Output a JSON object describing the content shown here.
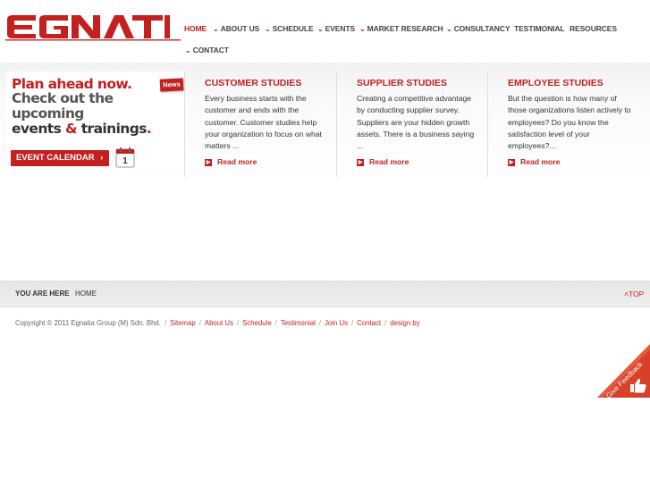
{
  "brand": {
    "logo_text": "EGNATIA",
    "accent": "#c42020"
  },
  "nav": {
    "items": [
      {
        "label": "HOME",
        "chevron": false,
        "active": true
      },
      {
        "label": "ABOUT US",
        "chevron": true
      },
      {
        "label": "SCHEDULE",
        "chevron": true
      },
      {
        "label": "EVENTS",
        "chevron": true
      },
      {
        "label": "MARKET RESEARCH",
        "chevron": true
      },
      {
        "label": "CONSULTANCY",
        "chevron": true
      },
      {
        "label": "TESTIMONIAL",
        "chevron": false
      },
      {
        "label": "RESOURCES",
        "chevron": false
      },
      {
        "label": "CONTACT",
        "chevron": true
      }
    ]
  },
  "banner": {
    "line1": "Plan ahead now.",
    "line2": "Check out the",
    "line3": "upcoming",
    "line4_a": "events ",
    "line4_amp": "&",
    "line4_b": " trainings",
    "line4_dot": ".",
    "news_tag": "News",
    "button_label": "EVENT CALENDAR",
    "button_arrow": "›",
    "calendar_day": "1"
  },
  "columns": [
    {
      "title": "CUSTOMER STUDIES",
      "body": "Every business starts with the customer and ends with the customer. Customer studies help your organization to focus on what matters ...",
      "readmore": "Read more"
    },
    {
      "title": "SUPPLIER STUDIES",
      "body": "Creating a competitive advantage by conducting supplier survey. Suppliers are your hidden growth assets. There is a business saying ...",
      "readmore": "Read more"
    },
    {
      "title": "EMPLOYEE STUDIES",
      "body": "But the question is how many of those organizations listen actively to employees? Do you know the satisfaction level of your employees?...",
      "readmore": "Read more"
    }
  ],
  "breadcrumb": {
    "label": "YOU ARE HERE",
    "current": "HOME",
    "top_link": "TOP"
  },
  "footer": {
    "copyright": "Copyright © 2011 Egnatia Group (M) Sdn. Bhd.",
    "links": [
      "Sitemap",
      "About Us",
      "Schedule",
      "Testimonial",
      "Join Us",
      "Contact",
      "design by"
    ]
  },
  "feedback": {
    "label": "Give Feedback"
  },
  "icons": {
    "nav_chevron": "chevron-down-icon",
    "readmore": "arrow-right-icon",
    "calendar": "calendar-icon",
    "thumbs_up": "thumbs-up-icon",
    "top_arrow": "chevron-up-icon"
  }
}
